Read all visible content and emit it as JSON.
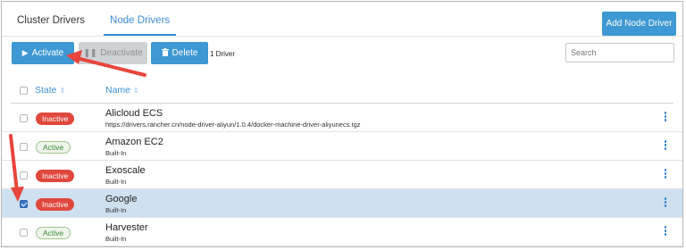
{
  "tabs": [
    {
      "label": "Cluster Drivers",
      "active": false
    },
    {
      "label": "Node Drivers",
      "active": true
    }
  ],
  "toolbar": {
    "add_label": "Add Node Driver",
    "activate_label": "Activate",
    "deactivate_label": "Deactivate",
    "delete_label": "Delete",
    "count_text": "1 Driver",
    "search_placeholder": "Search"
  },
  "table": {
    "columns": [
      "State",
      "Name"
    ],
    "rows": [
      {
        "state": "Inactive",
        "name": "Alicloud ECS",
        "detail": "https://drivers.rancher.cn/node-driver-aliyun/1.0.4/docker-machine-driver-aliyunecs.tgz",
        "selected": false
      },
      {
        "state": "Active",
        "name": "Amazon EC2",
        "detail": "Built-In",
        "selected": false
      },
      {
        "state": "Inactive",
        "name": "Exoscale",
        "detail": "Built-In",
        "selected": false
      },
      {
        "state": "Inactive",
        "name": "Google",
        "detail": "Built-In",
        "selected": true
      },
      {
        "state": "Active",
        "name": "Harvester",
        "detail": "Built-In",
        "selected": false
      }
    ]
  },
  "colors": {
    "accent": "#3d98d3",
    "inactive": "#e0483d",
    "active_text": "#3e8a37",
    "selected_row": "#cfe0f0",
    "annotation_arrow": "#e8453c"
  },
  "icons": {
    "activate": "play-icon",
    "deactivate": "pause-icon",
    "delete": "trash-icon",
    "row_menu": "kebab-menu-icon"
  }
}
